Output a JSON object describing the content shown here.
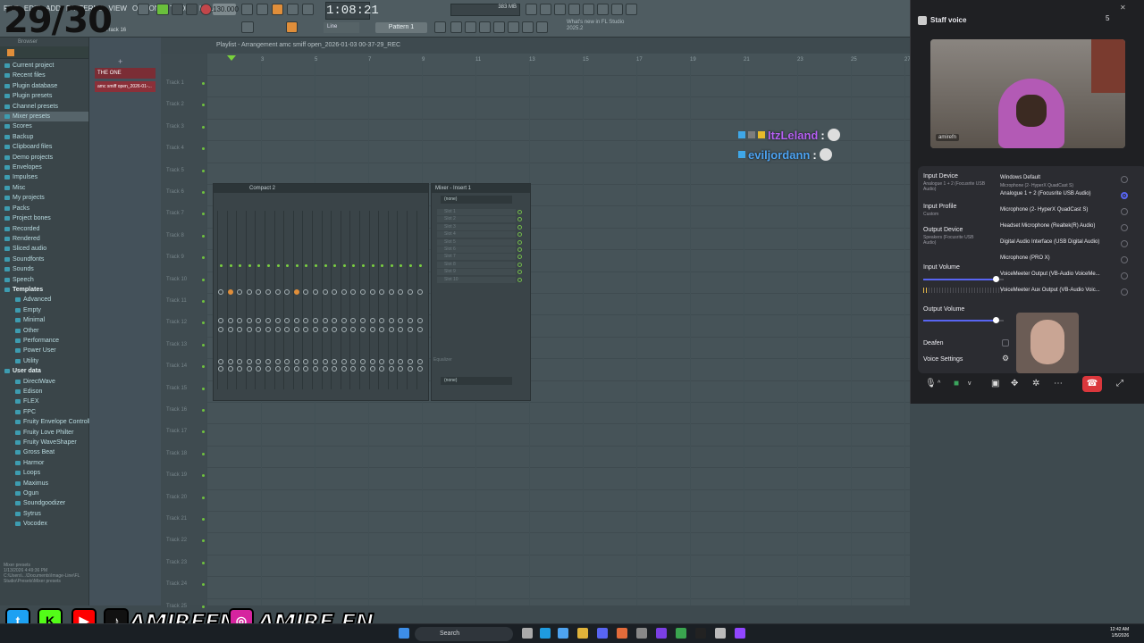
{
  "overlay_counter": "29/30",
  "daw": {
    "menu": [
      "FILE",
      "EDIT",
      "ADD",
      "PATTERNS",
      "VIEW",
      "OPTIONS",
      "TOOLS",
      "HELP"
    ],
    "tempo": "130.000",
    "time": "1:08:21",
    "pattern": "Pattern 1",
    "track_label": "Track 16",
    "ram": "383 MB",
    "news": "What's new in FL Studio 2025.2",
    "playlist_title": "Playlist - Arrangement  amc smiff open_2026-01-03 00-37-29_REC",
    "browser_title": "Browser",
    "track_one": "THE ONE",
    "arrangement_block": "amc smiff open_2026-01-...",
    "browser_items": [
      {
        "label": "Current project",
        "cls": ""
      },
      {
        "label": "Recent files",
        "cls": ""
      },
      {
        "label": "Plugin database",
        "cls": ""
      },
      {
        "label": "Plugin presets",
        "cls": ""
      },
      {
        "label": "Channel presets",
        "cls": ""
      },
      {
        "label": "Mixer presets",
        "cls": "hl"
      },
      {
        "label": "Scores",
        "cls": ""
      },
      {
        "label": "Backup",
        "cls": ""
      },
      {
        "label": "Clipboard files",
        "cls": ""
      },
      {
        "label": "Demo projects",
        "cls": ""
      },
      {
        "label": "Envelopes",
        "cls": ""
      },
      {
        "label": "Impulses",
        "cls": ""
      },
      {
        "label": "Misc",
        "cls": ""
      },
      {
        "label": "My projects",
        "cls": ""
      },
      {
        "label": "Packs",
        "cls": ""
      },
      {
        "label": "Project bones",
        "cls": ""
      },
      {
        "label": "Recorded",
        "cls": ""
      },
      {
        "label": "Rendered",
        "cls": ""
      },
      {
        "label": "Sliced audio",
        "cls": ""
      },
      {
        "label": "Soundfonts",
        "cls": ""
      },
      {
        "label": "Sounds",
        "cls": ""
      },
      {
        "label": "Speech",
        "cls": ""
      },
      {
        "label": "Templates",
        "cls": "open"
      },
      {
        "label": "Advanced",
        "cls": "sub"
      },
      {
        "label": "Empty",
        "cls": "sub"
      },
      {
        "label": "Minimal",
        "cls": "sub"
      },
      {
        "label": "Other",
        "cls": "sub"
      },
      {
        "label": "Performance",
        "cls": "sub"
      },
      {
        "label": "Power User",
        "cls": "sub"
      },
      {
        "label": "Utility",
        "cls": "sub"
      },
      {
        "label": "User data",
        "cls": "open"
      },
      {
        "label": "DirectWave",
        "cls": "sub"
      },
      {
        "label": "Edison",
        "cls": "sub"
      },
      {
        "label": "FLEX",
        "cls": "sub"
      },
      {
        "label": "FPC",
        "cls": "sub"
      },
      {
        "label": "Fruity Envelope Controller",
        "cls": "sub"
      },
      {
        "label": "Fruity Love Philter",
        "cls": "sub"
      },
      {
        "label": "Fruity WaveShaper",
        "cls": "sub"
      },
      {
        "label": "Gross Beat",
        "cls": "sub"
      },
      {
        "label": "Harmor",
        "cls": "sub"
      },
      {
        "label": "Loops",
        "cls": "sub"
      },
      {
        "label": "Maximus",
        "cls": "sub"
      },
      {
        "label": "Ogun",
        "cls": "sub"
      },
      {
        "label": "Soundgoodizer",
        "cls": "sub"
      },
      {
        "label": "Sytrus",
        "cls": "sub"
      },
      {
        "label": "Vocodex",
        "cls": "sub"
      }
    ],
    "browser_footer": "Mixer presets\n1/13/2026 4:49:36 PM\nC:\\Users\\...\\Documents\\Image-Line\\FL Studio\\Presets\\Mixer presets",
    "bar_numbers": [
      "3",
      "5",
      "7",
      "9",
      "11",
      "13",
      "15",
      "17",
      "19",
      "21",
      "23",
      "25",
      "27"
    ],
    "track_names": [
      "Track 1",
      "Track 2",
      "Track 3",
      "Track 4",
      "Track 5",
      "Track 6",
      "Track 7",
      "Track 8",
      "Track 9",
      "Track 10",
      "Track 11",
      "Track 12",
      "Track 13",
      "Track 14",
      "Track 15",
      "Track 16",
      "Track 17",
      "Track 18",
      "Track 19",
      "Track 20",
      "Track 21",
      "Track 22",
      "Track 23",
      "Track 24",
      "Track 25"
    ],
    "mixer_title": "Compact 2",
    "insert_title": "Mixer - Insert 1",
    "insert_preset": "(none)",
    "insert_slots": [
      "Slot 1",
      "Slot 2",
      "Slot 3",
      "Slot 4",
      "Slot 5",
      "Slot 6",
      "Slot 7",
      "Slot 8",
      "Slot 9",
      "Slot 10"
    ],
    "insert_eq": "Equalizer",
    "insert_out": "(none)"
  },
  "chat": [
    {
      "user": "ItzLeland",
      "color": "#b560f2"
    },
    {
      "user": "eviljordann",
      "color": "#4da3f2"
    }
  ],
  "discord": {
    "title": "Staff voice",
    "member_count": "5",
    "cam_name": "amirefn",
    "input_device_label": "Input Device",
    "input_device_value": "Analogue 1 + 2 (Focusrite USB Audio)",
    "input_profile_label": "Input Profile",
    "input_profile_value": "Custom",
    "output_device_label": "Output Device",
    "output_device_value": "Speakers (Focusrite USB Audio)",
    "input_volume_label": "Input Volume",
    "input_volume_level": 0.9,
    "output_volume_label": "Output Volume",
    "output_volume_level": 0.9,
    "deafen_label": "Deafen",
    "voice_settings_label": "Voice Settings",
    "devices": [
      {
        "name": "Windows Default",
        "sub": "Microphone (2- HyperX QuadCast S)",
        "selected": false
      },
      {
        "name": "Analogue 1 + 2 (Focusrite USB Audio)",
        "sub": "",
        "selected": true
      },
      {
        "name": "Microphone (2- HyperX QuadCast S)",
        "sub": "",
        "selected": false
      },
      {
        "name": "Headset Microphone (Realtek(R) Audio)",
        "sub": "",
        "selected": false
      },
      {
        "name": "Digital Audio Interface (USB Digital Audio)",
        "sub": "",
        "selected": false
      },
      {
        "name": "Microphone (PRO X)",
        "sub": "",
        "selected": false
      },
      {
        "name": "VoiceMeeter Output (VB-Audio VoiceMe...",
        "sub": "",
        "selected": false
      },
      {
        "name": "VoiceMeeter Aux Output (VB-Audio Voic...",
        "sub": "",
        "selected": false
      }
    ]
  },
  "social": {
    "handle1": "AMIREFN",
    "handle2": "AMIRE.FN"
  },
  "taskbar": {
    "search": "Search",
    "time": "12:42 AM",
    "date": "1/5/2026"
  }
}
